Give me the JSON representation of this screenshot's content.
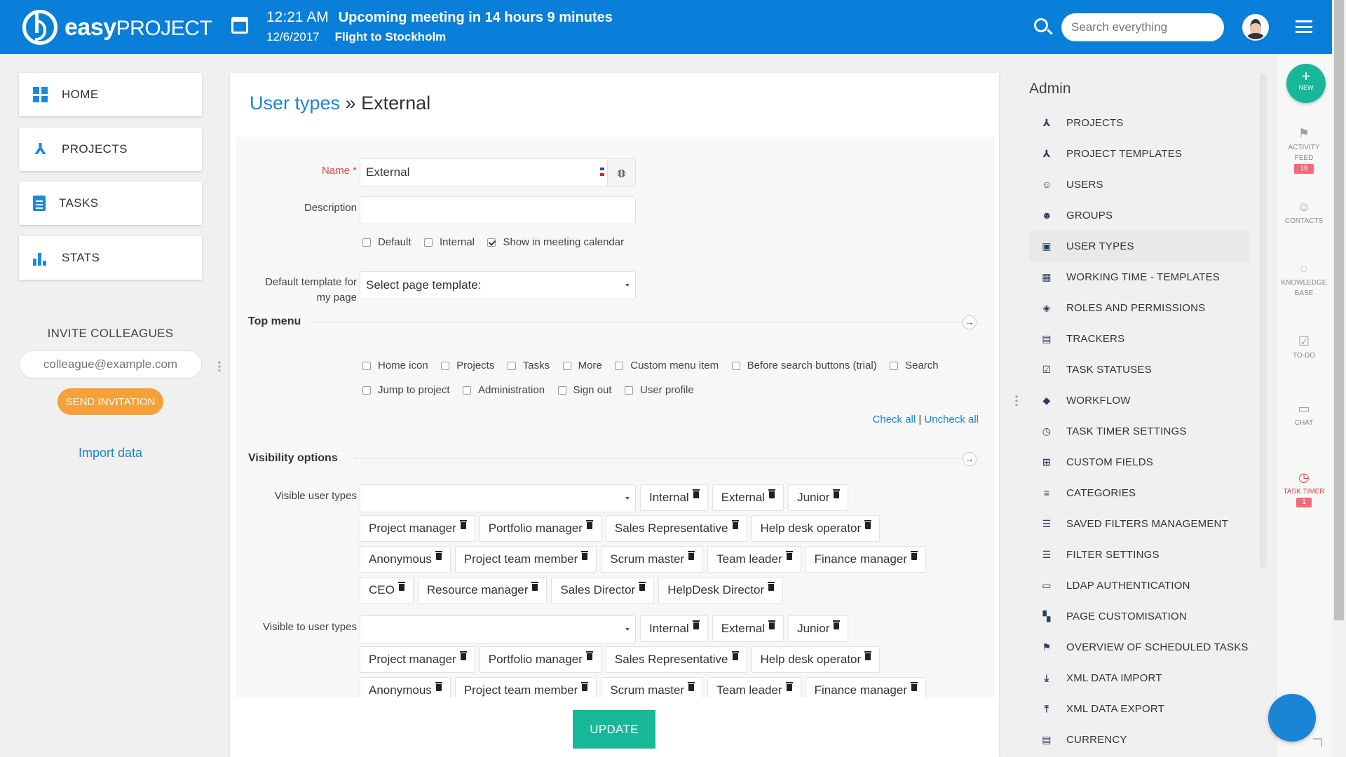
{
  "header": {
    "logo_bold": "easy",
    "logo_light": "PROJECT",
    "time": "12:21 AM",
    "meeting": "Upcoming meeting in 14 hours 9 minutes",
    "date": "12/6/2017",
    "event": "Flight to Stockholm",
    "search_placeholder": "Search everything"
  },
  "sidebar": {
    "items": [
      {
        "label": "HOME",
        "icon": "dashboard-icon"
      },
      {
        "label": "PROJECTS",
        "icon": "projects-icon"
      },
      {
        "label": "TASKS",
        "icon": "clipboard-icon"
      },
      {
        "label": "STATS",
        "icon": "bar-chart-icon"
      }
    ],
    "invite_title": "INVITE COLLEAGUES",
    "invite_placeholder": "colleague@example.com",
    "send_button": "SEND INVITATION",
    "import_link": "Import data"
  },
  "main": {
    "breadcrumb": "User types",
    "separator": " » ",
    "title": "External",
    "name_label": "Name",
    "required_mark": " *",
    "name_value": "External",
    "description_label": "Description",
    "checkboxes": [
      {
        "label": "Default",
        "checked": false
      },
      {
        "label": "Internal",
        "checked": false
      },
      {
        "label": "Show in meeting calendar",
        "checked": true
      }
    ],
    "template_label_1": "Default template for",
    "template_label_2": "my page",
    "template_select": "Select page template:",
    "top_menu_title": "Top menu",
    "top_menu_row1": [
      "Home icon",
      "Projects",
      "Tasks",
      "More",
      "Custom menu item",
      "Before search buttons (trial)",
      "Search"
    ],
    "top_menu_row2": [
      "Jump to project",
      "Administration",
      "Sign out",
      "User profile"
    ],
    "check_all": "Check all",
    "link_separator": " | ",
    "uncheck_all": "Uncheck all",
    "visibility_title": "Visibility options",
    "visible_user_types_label": "Visible user types",
    "visible_to_user_types_label": "Visible to user types",
    "visible_tags": [
      "Internal",
      "External",
      "Junior",
      "Project manager",
      "Portfolio manager",
      "Sales Representative",
      "Help desk operator",
      "Anonymous",
      "Project team member",
      "Scrum master",
      "Team leader",
      "Finance manager",
      "CEO",
      "Resource manager",
      "Sales Director",
      "HelpDesk Director"
    ],
    "visible_to_tags": [
      "Internal",
      "External",
      "Junior",
      "Project manager",
      "Portfolio manager",
      "Sales Representative",
      "Help desk operator",
      "Anonymous",
      "Project team member",
      "Scrum master",
      "Team leader",
      "Finance manager"
    ],
    "update_button": "UPDATE"
  },
  "admin": {
    "title": "Admin",
    "items": [
      {
        "label": "PROJECTS",
        "icon": "projects-icon",
        "active": false
      },
      {
        "label": "PROJECT TEMPLATES",
        "icon": "project-templates-icon",
        "active": false
      },
      {
        "label": "USERS",
        "icon": "user-icon",
        "active": false
      },
      {
        "label": "GROUPS",
        "icon": "group-icon",
        "active": false
      },
      {
        "label": "USER TYPES",
        "icon": "user-types-icon",
        "active": true
      },
      {
        "label": "WORKING TIME - TEMPLATES",
        "icon": "calendar-icon",
        "active": false
      },
      {
        "label": "ROLES AND PERMISSIONS",
        "icon": "shield-icon",
        "active": false
      },
      {
        "label": "TRACKERS",
        "icon": "clipboard-icon",
        "active": false
      },
      {
        "label": "TASK STATUSES",
        "icon": "checkbox-icon",
        "active": false
      },
      {
        "label": "WORKFLOW",
        "icon": "workflow-icon",
        "active": false
      },
      {
        "label": "TASK TIMER SETTINGS",
        "icon": "alarm-icon",
        "active": false
      },
      {
        "label": "CUSTOM FIELDS",
        "icon": "plus-square-icon",
        "active": false
      },
      {
        "label": "CATEGORIES",
        "icon": "list-icon",
        "active": false
      },
      {
        "label": "SAVED FILTERS MANAGEMENT",
        "icon": "filter-icon",
        "active": false
      },
      {
        "label": "FILTER SETTINGS",
        "icon": "filter-icon",
        "active": false
      },
      {
        "label": "LDAP AUTHENTICATION",
        "icon": "ldap-icon",
        "active": false
      },
      {
        "label": "PAGE CUSTOMISATION",
        "icon": "dashboard-icon",
        "active": false
      },
      {
        "label": "OVERVIEW OF SCHEDULED TASKS",
        "icon": "flag-icon",
        "active": false
      },
      {
        "label": "XML DATA IMPORT",
        "icon": "download-icon",
        "active": false
      },
      {
        "label": "XML DATA EXPORT",
        "icon": "upload-icon",
        "active": false
      },
      {
        "label": "CURRENCY",
        "icon": "currency-icon",
        "active": false
      }
    ]
  },
  "rail": {
    "new_label": "NEW",
    "activity_1": "ACTIVITY",
    "activity_2": "FEED",
    "activity_badge": "16",
    "contacts": "CONTACTS",
    "kb_1": "KNOWLEDGE",
    "kb_2": "BASE",
    "todo": "TO-DO",
    "chat": "CHAT",
    "timer": "TASK TIMER",
    "timer_badge": "1"
  },
  "colors": {
    "header": "#0a7fd9",
    "accent": "#1a84d6",
    "update": "#17b897",
    "invite": "#f5a03a"
  }
}
